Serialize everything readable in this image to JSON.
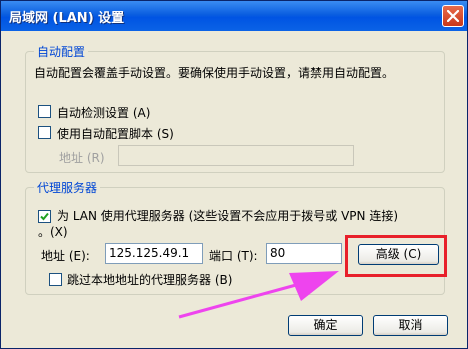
{
  "window": {
    "title": "局域网 (LAN) 设置"
  },
  "auto_config": {
    "legend": "自动配置",
    "description": "自动配置会覆盖手动设置。要确保使用手动设置，请禁用自动配置。",
    "detect_label": "自动检测设置 (A)",
    "detect_checked": false,
    "script_label": "使用自动配置脚本 (S)",
    "script_checked": false,
    "address_label": "地址 (R)",
    "address_value": ""
  },
  "proxy": {
    "legend": "代理服务器",
    "use_proxy_label_line1": "为 LAN 使用代理服务器 (这些设置不会应用于拨号或 VPN 连接)",
    "use_proxy_label_line2": "。(X)",
    "use_proxy_checked": true,
    "address_label": "地址 (E):",
    "address_value": "125.125.49.1",
    "port_label": "端口 (T):",
    "port_value": "80",
    "advanced_label": "高级 (C)",
    "bypass_label": "跳过本地地址的代理服务器 (B)",
    "bypass_checked": false
  },
  "buttons": {
    "ok": "确定",
    "cancel": "取消"
  },
  "colors": {
    "title_bar": "#0054e3",
    "highlight": "#e8202a",
    "arrow": "#ee44ee",
    "group_legend": "#0046d5"
  }
}
